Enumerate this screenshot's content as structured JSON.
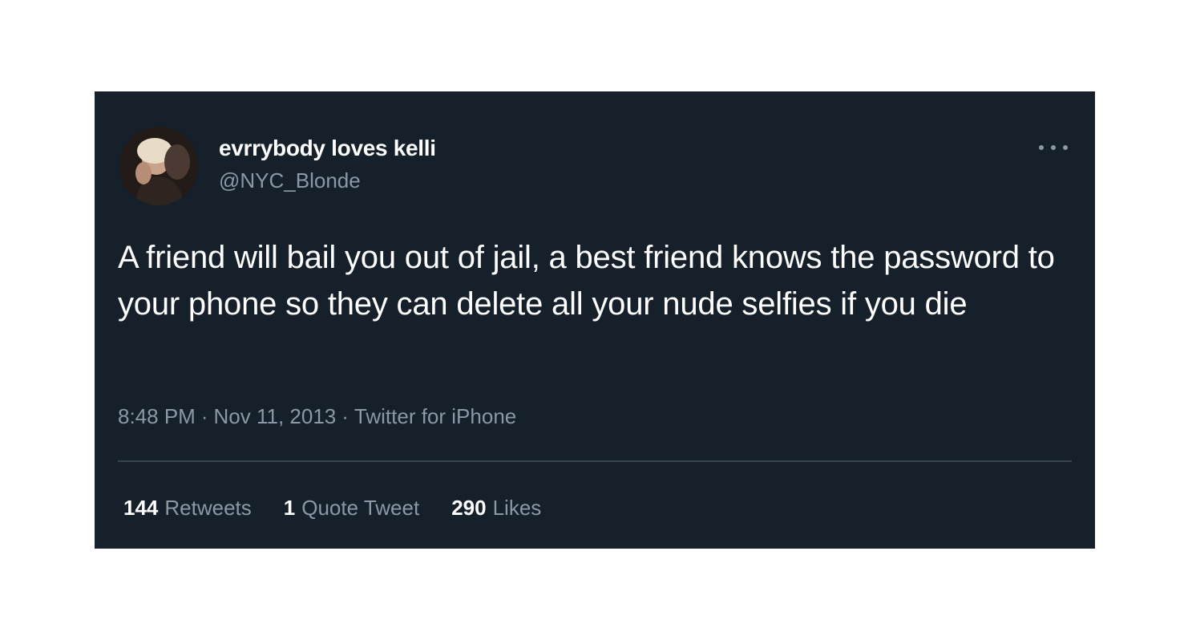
{
  "tweet": {
    "display_name": "evrrybody loves kelli",
    "handle": "@NYC_Blonde",
    "more_icon": "more-horizontal-icon",
    "text": "A friend will bail you out of jail, a best friend knows the password to your phone so they can delete all your nude selfies if you die",
    "time": "8:48 PM",
    "date": "Nov 11, 2013",
    "source": "Twitter for iPhone",
    "separator": "·"
  },
  "stats": {
    "retweets_count": "144",
    "retweets_label": "Retweets",
    "quotes_count": "1",
    "quotes_label": "Quote Tweet",
    "likes_count": "290",
    "likes_label": "Likes"
  },
  "colors": {
    "card_background": "#15202b",
    "primary_text": "#ffffff",
    "secondary_text": "#8b98a5",
    "divider": "#38444d"
  }
}
